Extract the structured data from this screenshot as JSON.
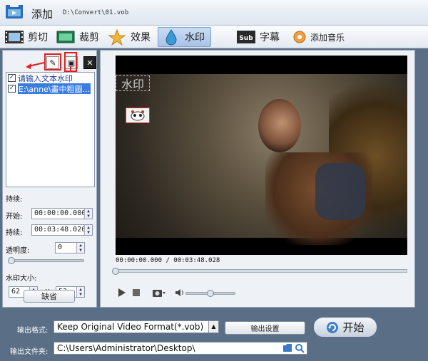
{
  "titlebar": {
    "title": "添加",
    "path": "D:\\Convert\\01.vob"
  },
  "toolbar": {
    "cut": "剪切",
    "crop": "裁剪",
    "effect": "效果",
    "watermark": "水印",
    "subtitle": "字幕",
    "music": "添加音乐"
  },
  "left": {
    "items": [
      {
        "label": "请输入文本水印",
        "checked": true
      },
      {
        "label": "E:\\anne\\畫中粗圖...",
        "checked": true
      }
    ],
    "duration_label": "持续:",
    "start_label": "开始:",
    "start_value": "00:00:00.000",
    "dur_label": "持续:",
    "dur_value": "00:03:48.026",
    "opacity_label": "透明度:",
    "opacity_value": "0",
    "size_label": "水印大小:",
    "width_value": "62",
    "x_label": "X",
    "height_value": "53",
    "default_button": "缺省"
  },
  "preview": {
    "watermark_text": "水印",
    "time": "00:00:00.000 / 00:03:48.028",
    "opacity_fraction": 0.0,
    "volume_fraction": 0.5
  },
  "bottom": {
    "format_label": "输出格式:",
    "format_value": "Keep Original Video Format(*.vob)",
    "settings_button": "输出设置",
    "start_button": "开始",
    "folder_label": "输出文件夹:",
    "folder_value": "C:\\Users\\Administrator\\Desktop\\"
  },
  "colors": {
    "panel_bg": "#5a6f86",
    "arrow_red": "#e02020",
    "selection": "#3a7de0"
  }
}
